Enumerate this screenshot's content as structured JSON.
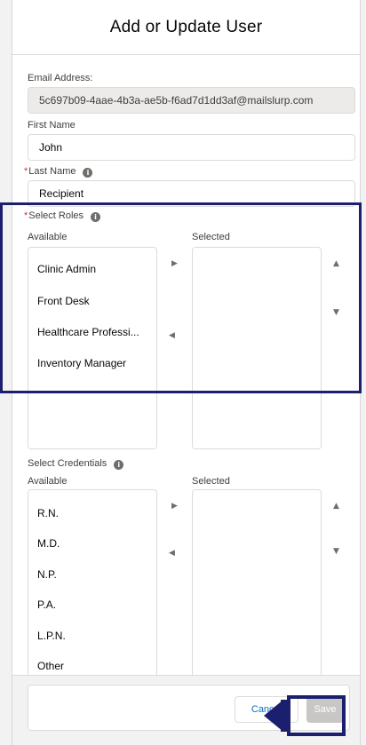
{
  "modal": {
    "title": "Add or Update User"
  },
  "form": {
    "email": {
      "label": "Email Address:",
      "value": "5c697b09-4aae-4b3a-ae5b-f6ad7d1dd3af@mailslurp.com"
    },
    "first_name": {
      "label": "First Name",
      "value": "John"
    },
    "last_name": {
      "label": "Last Name",
      "value": "Recipient",
      "required": true
    },
    "roles": {
      "label": "Select Roles",
      "required": true,
      "available_label": "Available",
      "selected_label": "Selected",
      "available": [
        "Clinic Admin",
        "Front Desk",
        "Healthcare Professi...",
        "Inventory Manager"
      ],
      "selected": []
    },
    "credentials": {
      "label": "Select Credentials",
      "available_label": "Available",
      "selected_label": "Selected",
      "available": [
        "R.N.",
        "M.D.",
        "N.P.",
        "P.A.",
        "L.P.N.",
        "Other"
      ],
      "selected": []
    }
  },
  "footer": {
    "cancel_label": "Cancel",
    "save_label": "Save"
  },
  "icons": {
    "info": "i",
    "move_right": "▶",
    "move_left": "◀",
    "move_up": "▲",
    "move_down": "▼"
  },
  "colors": {
    "required": "#c23934",
    "highlight": "#1b1f6e",
    "link": "#0070d2",
    "save_disabled": "#c9c7c5"
  }
}
